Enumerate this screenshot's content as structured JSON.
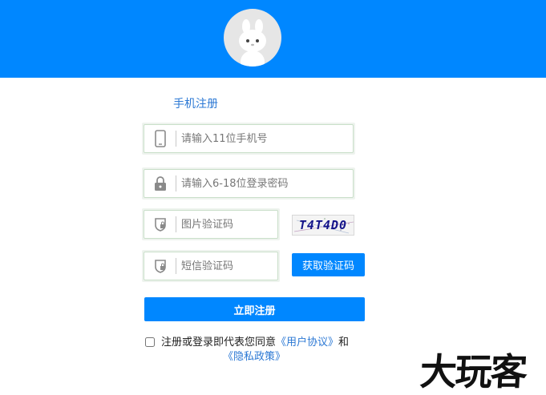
{
  "form": {
    "title": "手机注册",
    "phone_placeholder": "请输入11位手机号",
    "password_placeholder": "请输入6-18位登录密码",
    "captcha_placeholder": "图片验证码",
    "sms_placeholder": "短信验证码",
    "captcha_text": "T4T4D0",
    "get_code_label": "获取验证码",
    "submit_label": "立即注册"
  },
  "agreement": {
    "prefix": "注册或登录即代表您同意",
    "user_agreement": "《用户协议》",
    "conjunction": "和",
    "privacy_policy": "《隐私政策》"
  },
  "watermark": "大玩客",
  "icons": {
    "phone": "phone-icon",
    "lock": "lock-icon",
    "shield": "shield-icon",
    "avatar": "rabbit-mascot"
  },
  "colors": {
    "brand_blue": "#0087ff",
    "link_blue": "#2b78d4"
  }
}
